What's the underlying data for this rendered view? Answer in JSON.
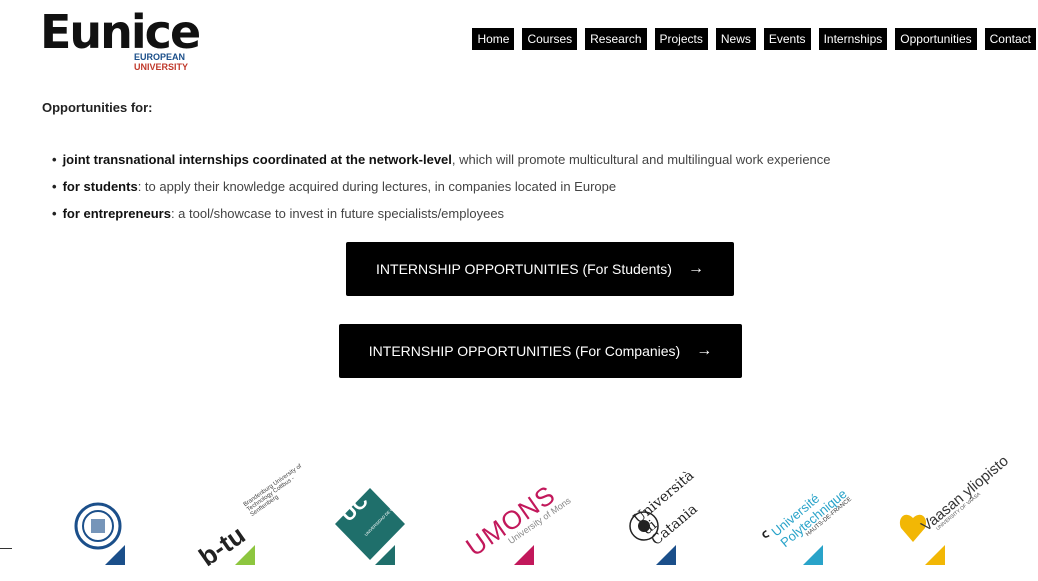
{
  "logo": {
    "name": "Eunice",
    "line1": "EUROPEAN",
    "line2": "UNIVERSITY"
  },
  "nav": {
    "items": [
      "Home",
      "Courses",
      "Research",
      "Projects",
      "News",
      "Events",
      "Internships",
      "Opportunities",
      "Contact"
    ]
  },
  "content": {
    "intro": "Opportunities for:",
    "bullets": [
      {
        "bold": "joint transnational internships coordinated at the network-level",
        "rest": ", which will promote multicultural and multilingual work experience"
      },
      {
        "bold": "for students",
        "rest": ": to apply their knowledge acquired during lectures, in companies located in Europe"
      },
      {
        "bold": "for entrepreneurs",
        "rest": ": a tool/showcase to invest in future specialists/employees"
      }
    ]
  },
  "cta": {
    "students": "INTERNSHIP OPPORTUNITIES (For Students)",
    "companies": "INTERNSHIP OPPORTUNITIES (For Companies)",
    "arrow": "→"
  },
  "partners": [
    {
      "name": "poznan",
      "text": ""
    },
    {
      "name": "btu",
      "text": "b-tu",
      "sub": "Brandenburg University of Technology Cottbus - Senftenberg",
      "color": "#8dc63f"
    },
    {
      "name": "cantabria",
      "text": "UC",
      "sub": "UNIVERSIDAD DE CANTABRIA",
      "color": "#1f6f6b"
    },
    {
      "name": "umons",
      "text": "UMONS",
      "sub": "University of Mons",
      "color": "#c2185b"
    },
    {
      "name": "catania",
      "text": "Università di Catania",
      "color": "#1b4f8a"
    },
    {
      "name": "uphf",
      "text": "Université Polytechnique",
      "sub": "HAUTS-DE-FRANCE",
      "color": "#29a3c9"
    },
    {
      "name": "vaasa",
      "text": "Vaasan yliopisto",
      "sub": "UNIVERSITY OF VAASA",
      "color": "#f2b705"
    }
  ],
  "colors": {
    "nav_bg": "#000000",
    "button_bg": "#000000",
    "text": "#444444"
  }
}
